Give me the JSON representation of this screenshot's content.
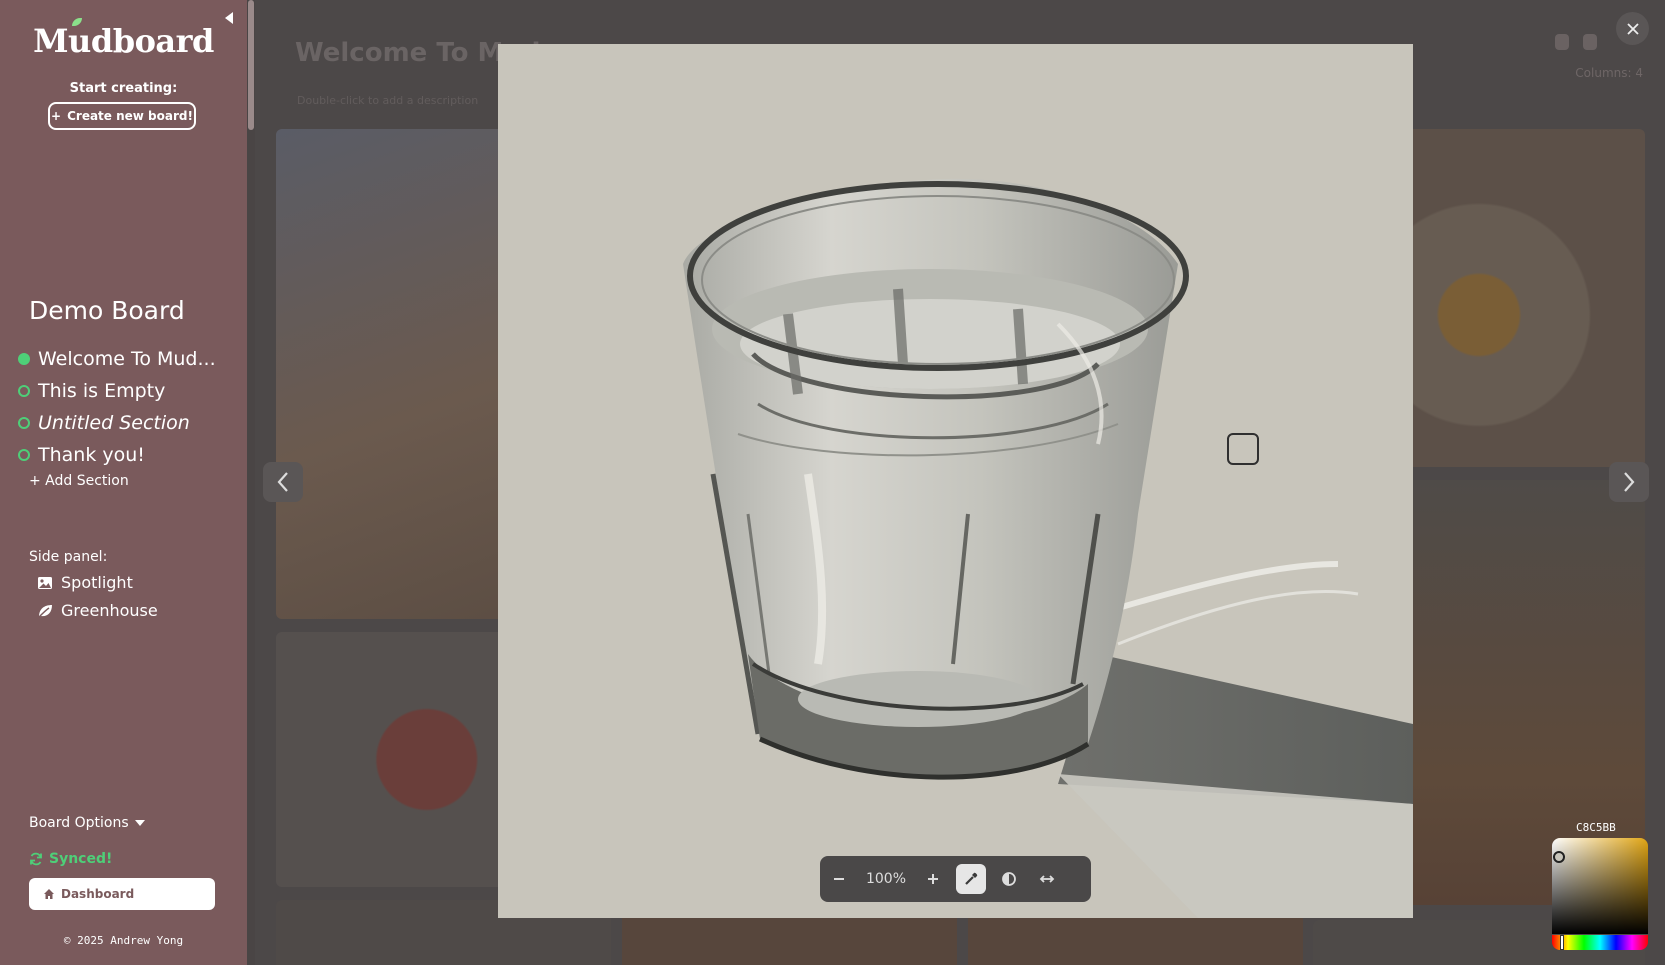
{
  "sidebar": {
    "logo": "Mudboard",
    "start_label": "Start creating:",
    "create_button": "Create new board!",
    "board_title": "Demo Board",
    "sections": [
      {
        "label": "Welcome To Mud...",
        "active": true
      },
      {
        "label": "This is Empty",
        "active": false
      },
      {
        "label": "Untitled Section",
        "active": false
      },
      {
        "label": "Thank you!",
        "active": false
      }
    ],
    "add_section": "+ Add Section",
    "side_panel_label": "Side panel:",
    "panel_items": [
      "Spotlight",
      "Greenhouse"
    ],
    "board_options": "Board Options",
    "synced": "Synced!",
    "dashboard": "Dashboard",
    "footer": "© 2025 Andrew Yong"
  },
  "board": {
    "title": "Welcome To Mud",
    "subtitle": "Double-click to add a description",
    "columns": "Columns: 4"
  },
  "viewer": {
    "zoom_level": "100%",
    "icons": [
      "minus-icon",
      "plus-icon",
      "eyedropper-icon",
      "contrast-icon",
      "flip-horizontal-icon"
    ]
  },
  "color_picker": {
    "hex": "C8C5BB",
    "sampled_color": "#c8c5bb"
  },
  "colors": {
    "sidebar_bg": "#7a5a5c",
    "accent_green": "#4ecf78",
    "overlay_bg": "#4c4848"
  }
}
